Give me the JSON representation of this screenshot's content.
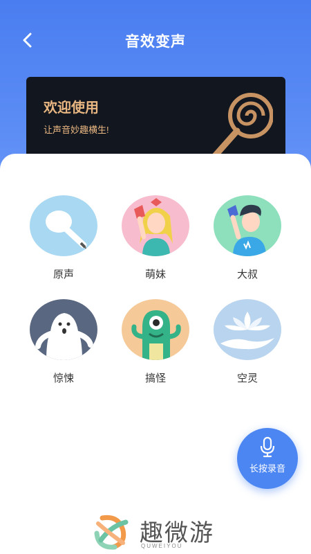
{
  "header": {
    "title": "音效变声"
  },
  "banner": {
    "title": "欢迎使用",
    "subtitle": "让声音妙趣横生!"
  },
  "effects": [
    {
      "label": "原声",
      "icon": "microphone-icon"
    },
    {
      "label": "萌妹",
      "icon": "cute-girl-icon"
    },
    {
      "label": "大叔",
      "icon": "uncle-icon"
    },
    {
      "label": "惊悚",
      "icon": "ghost-icon"
    },
    {
      "label": "搞怪",
      "icon": "monster-icon"
    },
    {
      "label": "空灵",
      "icon": "lotus-icon"
    }
  ],
  "record_button": {
    "label": "长按录音",
    "icon": "microphone-icon"
  },
  "watermark": {
    "name": "趣微游",
    "sub": "QUWEIYOU"
  },
  "colors": {
    "header_blue": "#4a7df0",
    "accent": "#4c86f2",
    "banner_gold": "#e9b781"
  }
}
